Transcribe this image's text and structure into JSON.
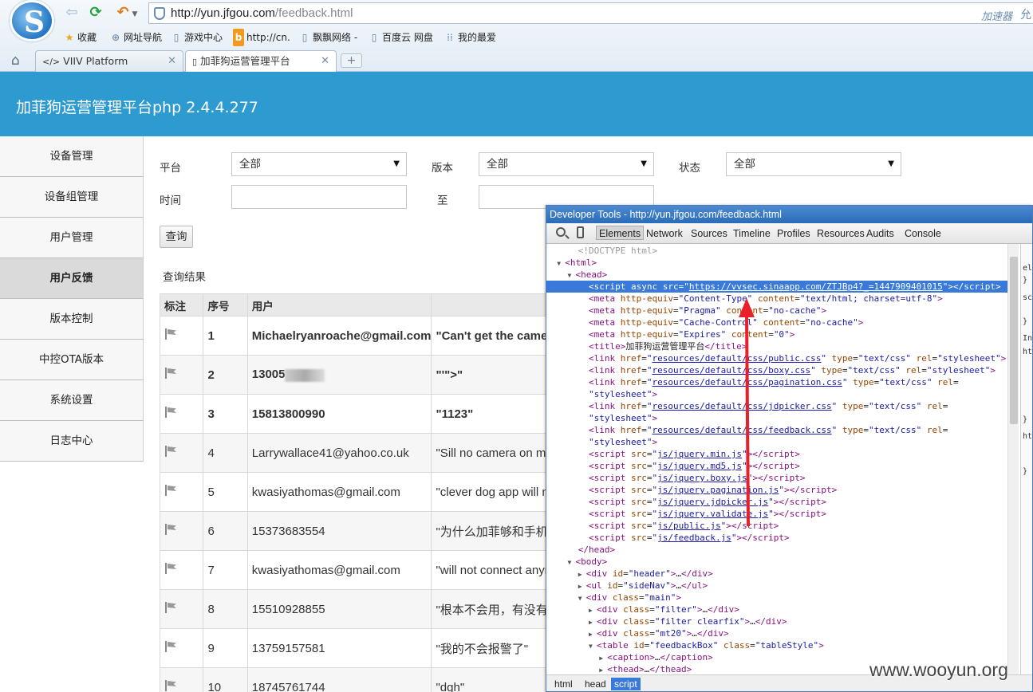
{
  "browser": {
    "address_host": "http://yun.jfgou.com",
    "address_path": "/feedback.html",
    "accelerator": "加速器",
    "address_extra": "允",
    "bookmarks": [
      {
        "icon": "star-icon",
        "glyph": "★",
        "label": "收藏"
      },
      {
        "icon": "globe-icon",
        "glyph": "⊕",
        "label": "网址导航"
      },
      {
        "icon": "page-icon",
        "glyph": "▯",
        "label": "游戏中心"
      },
      {
        "icon": "bing-icon",
        "glyph": "b",
        "label": "http://cn."
      },
      {
        "icon": "page-icon",
        "glyph": "▯",
        "label": "飘飘网络 -"
      },
      {
        "icon": "page-icon",
        "glyph": "▯",
        "label": "百度云 网盘"
      },
      {
        "icon": "grid-icon",
        "glyph": "⁞⁞",
        "label": "我的最爱"
      }
    ],
    "tabs": [
      {
        "icon": "</>",
        "label": "VIIV Platform"
      },
      {
        "icon": "▯",
        "label": "加菲狗运营管理平台"
      }
    ]
  },
  "app": {
    "title": "加菲狗运营管理平台php 2.4.4.277"
  },
  "sidebar": {
    "items": [
      {
        "label": "设备管理"
      },
      {
        "label": "设备组管理"
      },
      {
        "label": "用户管理"
      },
      {
        "label": "用户反馈"
      },
      {
        "label": "版本控制"
      },
      {
        "label": "中控OTA版本"
      },
      {
        "label": "系统设置"
      },
      {
        "label": "日志中心"
      }
    ]
  },
  "filters": {
    "platform_label": "平台",
    "platform_value": "全部",
    "version_label": "版本",
    "version_value": "全部",
    "status_label": "状态",
    "status_value": "全部",
    "time_label": "时间",
    "to_label": "至",
    "query_button": "查询",
    "results_caption": "查询结果"
  },
  "table": {
    "headers": [
      "标注",
      "序号",
      "用户",
      ""
    ],
    "rows": [
      {
        "no": "1",
        "user": "Michaelryanroache@gmail.com",
        "content": "\"Can't get the camera",
        "bold": true
      },
      {
        "no": "2",
        "user": "13005",
        "content": "\"'\">\"",
        "bold": true,
        "blur": true
      },
      {
        "no": "3",
        "user": "15813800990",
        "content": "\"1123\"",
        "bold": true
      },
      {
        "no": "4",
        "user": "Larrywallace41@yahoo.co.uk",
        "content": "\"Sill no camera on my",
        "bold": false
      },
      {
        "no": "5",
        "user": "kwasiyathomas@gmail.com",
        "content": "\"clever dog app will no",
        "bold": false
      },
      {
        "no": "6",
        "user": "15373683554",
        "content": "\"为什么加菲够和手机通讯",
        "bold": false
      },
      {
        "no": "7",
        "user": "kwasiyathomas@gmail.com",
        "content": "\"will not connect anym",
        "bold": false
      },
      {
        "no": "8",
        "user": "15510928855",
        "content": "\"根本不会用，有没有遥控",
        "bold": false
      },
      {
        "no": "9",
        "user": "13759157581",
        "content": "\"我的不会报警了\"",
        "bold": false
      },
      {
        "no": "10",
        "user": "18745761744",
        "content": "\"dgh\"",
        "bold": false
      }
    ]
  },
  "devtools": {
    "title": "Developer Tools - http://yun.jfgou.com/feedback.html",
    "tabs": [
      "Elements",
      "Network",
      "Sources",
      "Timeline",
      "Profiles",
      "Resources",
      "Audits",
      "Console"
    ],
    "active_tab": "Elements",
    "breadcrumbs": [
      "html",
      "head",
      "script"
    ],
    "styles_fragments": [
      "el",
      "}",
      "sc",
      "}",
      "In",
      "ht",
      "}",
      "ht",
      "}"
    ]
  },
  "watermark": "www.wooyun.org"
}
